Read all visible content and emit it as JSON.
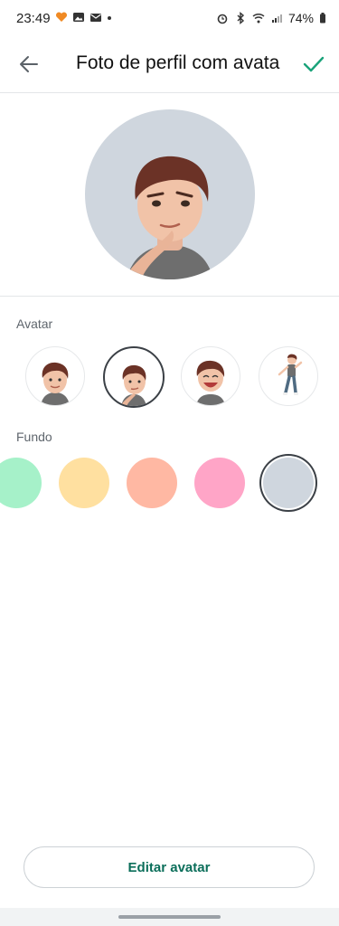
{
  "status_bar": {
    "time": "23:49",
    "battery": "74%"
  },
  "app_bar": {
    "title": "Foto de perfil com avatar",
    "back_icon": "arrow-left-icon",
    "confirm_icon": "check-icon",
    "accent_color": "#1aa37a"
  },
  "sections": {
    "avatar_label": "Avatar",
    "background_label": "Fundo"
  },
  "avatar_options": [
    {
      "name": "smiling-face",
      "selected": false
    },
    {
      "name": "thinking-pose",
      "selected": true
    },
    {
      "name": "laughing-face",
      "selected": false
    },
    {
      "name": "full-body-pose",
      "selected": false
    }
  ],
  "background_colors": [
    {
      "color": "#a6f1c9",
      "selected": false
    },
    {
      "color": "#ffe0a0",
      "selected": false
    },
    {
      "color": "#ffb8a3",
      "selected": false
    },
    {
      "color": "#ffa5c7",
      "selected": false
    },
    {
      "color": "#cfd6de",
      "selected": true
    }
  ],
  "edit_button": {
    "label": "Editar avatar"
  }
}
